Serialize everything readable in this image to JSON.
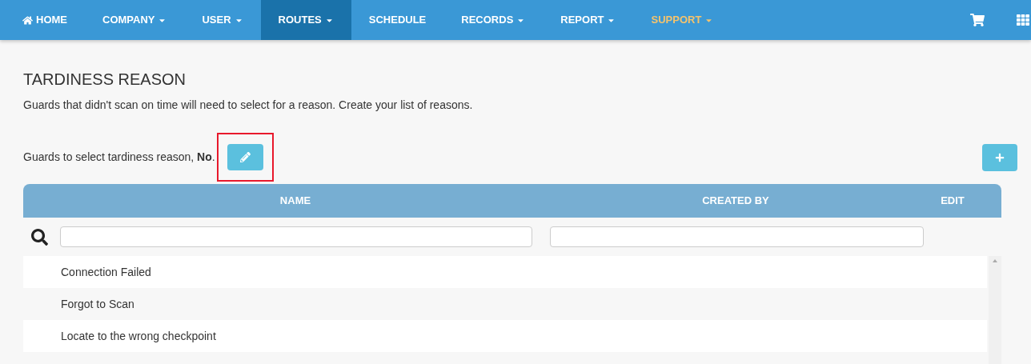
{
  "nav": {
    "items": [
      {
        "label": "HOME",
        "kind": "home",
        "dropdown": false,
        "selected": false,
        "highlighted": false
      },
      {
        "label": "COMPANY",
        "kind": "menu",
        "dropdown": true,
        "selected": false,
        "highlighted": false
      },
      {
        "label": "USER",
        "kind": "menu",
        "dropdown": true,
        "selected": false,
        "highlighted": false
      },
      {
        "label": "ROUTES",
        "kind": "menu",
        "dropdown": true,
        "selected": true,
        "highlighted": false
      },
      {
        "label": "SCHEDULE",
        "kind": "menu",
        "dropdown": false,
        "selected": false,
        "highlighted": false
      },
      {
        "label": "RECORDS",
        "kind": "menu",
        "dropdown": true,
        "selected": false,
        "highlighted": false
      },
      {
        "label": "REPORT",
        "kind": "menu",
        "dropdown": true,
        "selected": false,
        "highlighted": false
      },
      {
        "label": "SUPPORT",
        "kind": "menu",
        "dropdown": true,
        "selected": false,
        "highlighted": true
      }
    ]
  },
  "page": {
    "title": "TARDINESS REASON",
    "description": "Guards that didn't scan on time will need to select for a reason. Create your list of reasons.",
    "setting": "Guards to select tardiness reason, **No**.",
    "setting_highlighted": true
  },
  "table": {
    "columns": [
      "NAME",
      "CREATED BY",
      "EDIT"
    ],
    "rows": [
      {
        "name": "Connection Failed"
      },
      {
        "name": "Forgot to Scan"
      },
      {
        "name": "Locate to the wrong checkpoint"
      }
    ]
  }
}
